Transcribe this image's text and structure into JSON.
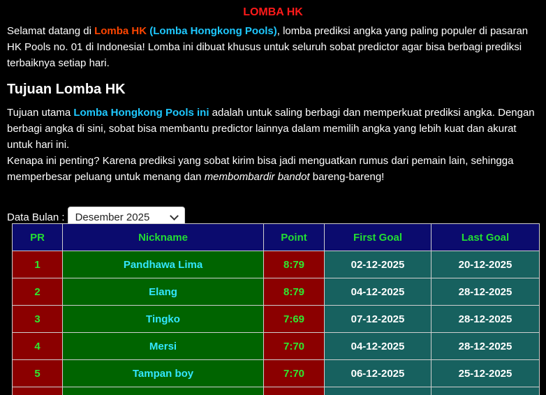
{
  "header": {
    "title": "LOMBA HK"
  },
  "intro": {
    "t1": "Selamat datang di ",
    "brand": "Lomba HK",
    "t2": " ",
    "brand_full": "(Lomba Hongkong Pools)",
    "t3": ", lomba prediksi angka yang paling populer di pasaran HK Pools no. 01 di Indonesia! Lomba ini dibuat khusus untuk seluruh sobat predictor agar bisa berbagi prediksi terbaiknya setiap hari."
  },
  "section": {
    "heading": "Tujuan Lomba HK",
    "p1_t1": "Tujuan utama ",
    "p1_link": "Lomba Hongkong Pools ini",
    "p1_t2": " adalah untuk saling berbagi dan memperkuat prediksi angka. Dengan berbagi angka di sini, sobat bisa membantu predictor lainnya dalam memilih angka yang lebih kuat dan akurat untuk hari ini.",
    "p2_t1": "Kenapa ini penting? Karena prediksi yang sobat kirim bisa jadi menguatkan rumus dari pemain lain, sehingga memperbesar peluang untuk menang dan ",
    "p2_em": "membombardir bandot",
    "p2_t2": " bareng-bareng!"
  },
  "filter": {
    "label": "Data Bulan :",
    "selected": "Desember 2025"
  },
  "table": {
    "headers": {
      "pr": "PR",
      "nickname": "Nickname",
      "point": "Point",
      "first_goal": "First Goal",
      "last_goal": "Last Goal"
    },
    "rows": [
      {
        "pr": "1",
        "nickname": "Pandhawa Lima",
        "point": "8:79",
        "first_goal": "02-12-2025",
        "last_goal": "20-12-2025"
      },
      {
        "pr": "2",
        "nickname": "Elang",
        "point": "8:79",
        "first_goal": "04-12-2025",
        "last_goal": "28-12-2025"
      },
      {
        "pr": "3",
        "nickname": "Tingko",
        "point": "7:69",
        "first_goal": "07-12-2025",
        "last_goal": "28-12-2025"
      },
      {
        "pr": "4",
        "nickname": "Mersi",
        "point": "7:70",
        "first_goal": "04-12-2025",
        "last_goal": "28-12-2025"
      },
      {
        "pr": "5",
        "nickname": "Tampan boy",
        "point": "7:70",
        "first_goal": "06-12-2025",
        "last_goal": "25-12-2025"
      },
      {
        "pr": "",
        "nickname": "",
        "point": "",
        "first_goal": "",
        "last_goal": ""
      }
    ]
  },
  "colors": {
    "title": "#ff1a1a",
    "brand": "#ff4500",
    "link": "#1ec8ff",
    "header_bg": "#0b0b6e",
    "header_text": "#22dd33",
    "rank_bg": "#8b0000",
    "nick_bg": "#006400",
    "date_bg": "#17615f"
  }
}
